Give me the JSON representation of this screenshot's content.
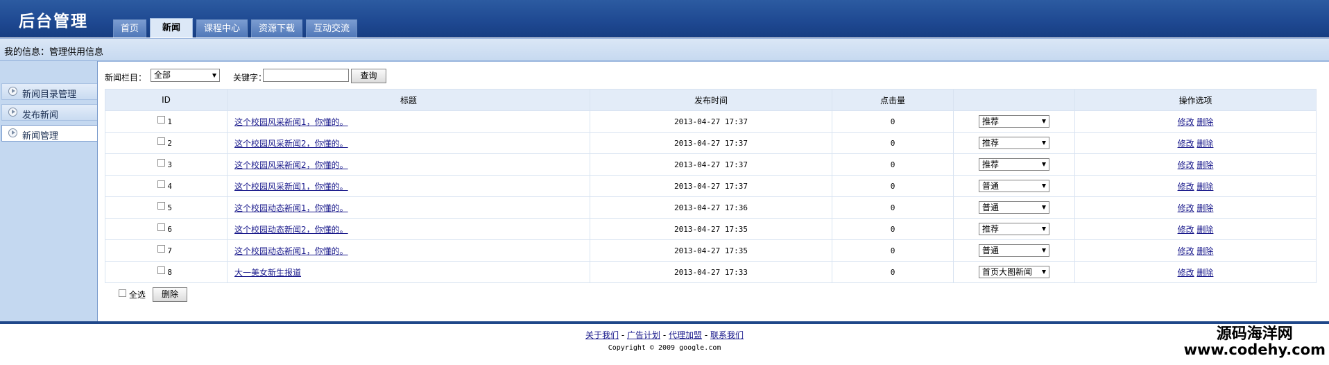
{
  "header": {
    "site_title": "后台管理",
    "nav_tabs": [
      {
        "label": "首页",
        "active": false
      },
      {
        "label": "新闻",
        "active": true
      },
      {
        "label": "课程中心",
        "active": false
      },
      {
        "label": "资源下载",
        "active": false
      },
      {
        "label": "互动交流",
        "active": false
      }
    ]
  },
  "infobar": {
    "text": "我的信息：管理供用信息"
  },
  "sidebar": {
    "items": [
      {
        "label": "新闻目录管理"
      },
      {
        "label": "发布新闻"
      },
      {
        "label": "新闻管理"
      }
    ]
  },
  "filter": {
    "category_label": "新闻栏目：",
    "category_value": "全部",
    "keyword_label": "关键字：",
    "keyword_value": "",
    "search_label": "查询"
  },
  "table": {
    "columns": [
      "ID",
      "标题",
      "发布时间",
      "点击量",
      "",
      "操作选项"
    ],
    "rows": [
      {
        "id": "1",
        "title": "这个校园风采新闻1，你懂的。",
        "time": "2013-04-27 17:37",
        "clicks": "0",
        "type": "推荐"
      },
      {
        "id": "2",
        "title": "这个校园风采新闻2，你懂的。",
        "time": "2013-04-27 17:37",
        "clicks": "0",
        "type": "推荐"
      },
      {
        "id": "3",
        "title": "这个校园风采新闻2，你懂的。",
        "time": "2013-04-27 17:37",
        "clicks": "0",
        "type": "推荐"
      },
      {
        "id": "4",
        "title": "这个校园风采新闻1，你懂的。",
        "time": "2013-04-27 17:37",
        "clicks": "0",
        "type": "普通"
      },
      {
        "id": "5",
        "title": "这个校园动态新闻1，你懂的。",
        "time": "2013-04-27 17:36",
        "clicks": "0",
        "type": "普通"
      },
      {
        "id": "6",
        "title": "这个校园动态新闻2，你懂的。",
        "time": "2013-04-27 17:35",
        "clicks": "0",
        "type": "推荐"
      },
      {
        "id": "7",
        "title": "这个校园动态新闻1，你懂的。",
        "time": "2013-04-27 17:35",
        "clicks": "0",
        "type": "普通"
      },
      {
        "id": "8",
        "title": "大一美女新生报道",
        "time": "2013-04-27 17:33",
        "clicks": "0",
        "type": "首页大图新闻"
      }
    ],
    "edit_label": "修改",
    "delete_label": "删除"
  },
  "bulk": {
    "select_all_label": "全选",
    "delete_label": "删除"
  },
  "footer": {
    "links": [
      "关于我们",
      "广告计划",
      "代理加盟",
      "联系我们"
    ],
    "separator": "-",
    "copyright": "Copyright © 2009 google.com"
  },
  "watermark": {
    "name": "源码海洋网",
    "url": "www.codehy.com"
  },
  "colors": {
    "header": "#1e4891",
    "infobar": "#c6d9f0",
    "sidebar": "#c4d8f0",
    "table_header": "#e3ecf8",
    "link": "#1a1a8c"
  }
}
